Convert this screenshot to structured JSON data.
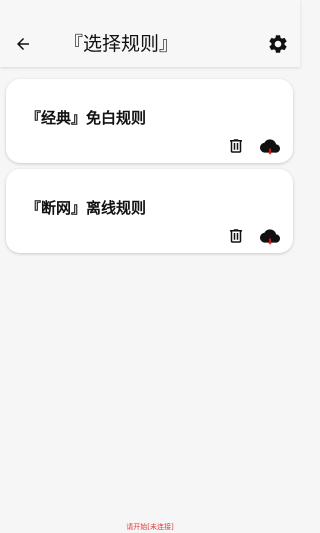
{
  "header": {
    "title": "『选择规则』",
    "back_icon": "arrow-left-icon",
    "settings_icon": "gear-icon"
  },
  "rules": [
    {
      "name": "『经典』免白规则",
      "actions": [
        "trash-icon",
        "cloud-download-icon"
      ]
    },
    {
      "name": "『断网』离线规则",
      "actions": [
        "trash-icon",
        "cloud-download-icon"
      ]
    }
  ],
  "status_text": "请开始[未连接]",
  "colors": {
    "background": "#f6f6f6",
    "card": "#ffffff",
    "status": "#e03a3a",
    "cloud_accent": "#e02020"
  }
}
